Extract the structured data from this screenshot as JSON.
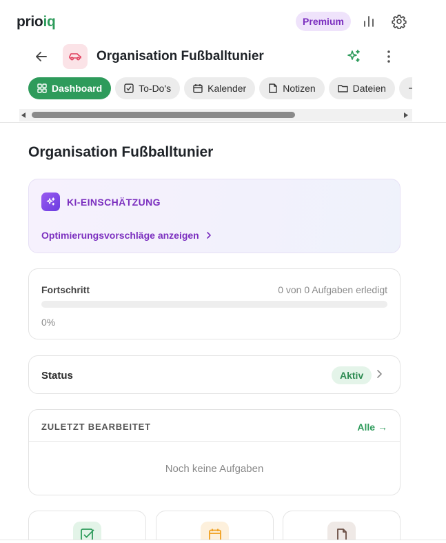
{
  "app": {
    "logo_main": "prio",
    "logo_accent": "iq",
    "premium_label": "Premium",
    "brand_color": "#2e9b5b",
    "ai_color": "#7b2fbf"
  },
  "header_icons": [
    "bar-chart-icon",
    "gear-icon"
  ],
  "project": {
    "title": "Organisation Fußballtunier",
    "icon": "car-icon"
  },
  "tabs": [
    {
      "label": "Dashboard",
      "icon": "dashboard-grid-icon",
      "active": true
    },
    {
      "label": "To-Do's",
      "icon": "checkbox-icon",
      "active": false
    },
    {
      "label": "Kalender",
      "icon": "calendar-icon",
      "active": false
    },
    {
      "label": "Notizen",
      "icon": "note-icon",
      "active": false
    },
    {
      "label": "Dateien",
      "icon": "folder-icon",
      "active": false
    }
  ],
  "main": {
    "page_title": "Organisation Fußballtunier",
    "ki": {
      "label": "KI-EINSCHÄTZUNG",
      "link": "Optimierungsvorschläge anzeigen"
    },
    "progress": {
      "label": "Fortschritt",
      "count_text": "0 von 0 Aufgaben erledigt",
      "percent_text": "0%",
      "value": 0
    },
    "status": {
      "label": "Status",
      "badge": "Aktiv"
    },
    "recent": {
      "title": "ZULETZT BEARBEITET",
      "all_link": "Alle →",
      "empty": "Noch keine Aufgaben"
    },
    "tiles": [
      {
        "icon": "checkbox-icon",
        "color": "#2e9b5b"
      },
      {
        "icon": "calendar-icon",
        "color": "#f0a020"
      },
      {
        "icon": "file-icon",
        "color": "#6b4f45"
      }
    ]
  }
}
